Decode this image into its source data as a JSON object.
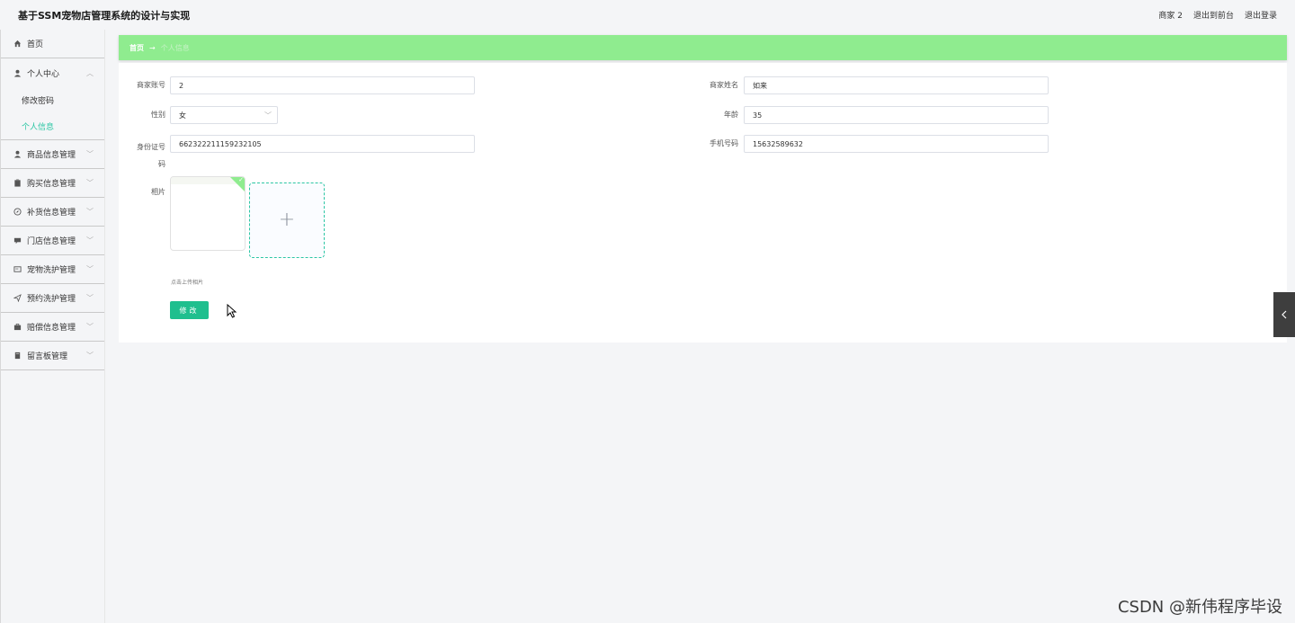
{
  "header": {
    "title": "基于SSM宠物店管理系统的设计与实现",
    "user": "商家 2",
    "front_link": "退出到前台",
    "logout": "退出登录"
  },
  "sidebar": {
    "items": [
      {
        "label": "首页",
        "icon": "home-icon"
      },
      {
        "label": "个人中心",
        "icon": "user-icon"
      },
      {
        "label": "修改密码"
      },
      {
        "label": "个人信息"
      },
      {
        "label": "商品信息管理",
        "icon": "user-icon"
      },
      {
        "label": "购买信息管理",
        "icon": "clipboard-icon"
      },
      {
        "label": "补货信息管理",
        "icon": "compass-icon"
      },
      {
        "label": "门店信息管理",
        "icon": "chat-icon"
      },
      {
        "label": "宠物洗护管理",
        "icon": "card-icon"
      },
      {
        "label": "预约洗护管理",
        "icon": "send-icon"
      },
      {
        "label": "赔偿信息管理",
        "icon": "briefcase-icon"
      },
      {
        "label": "留言板管理",
        "icon": "notebook-icon"
      }
    ]
  },
  "breadcrumb": {
    "home": "首页",
    "current": "个人信息"
  },
  "form": {
    "account_label": "商家账号",
    "account_value": "2",
    "name_label": "商家姓名",
    "name_value": "如来",
    "gender_label": "性别",
    "gender_value": "女",
    "age_label": "年龄",
    "age_value": "35",
    "idcard_label": "身份证号码",
    "idcard_value": "662322211159232105",
    "phone_label": "手机号码",
    "phone_value": "15632589632",
    "photo_label": "相片",
    "upload_hint": "点击上传相片",
    "submit_label": "修改"
  },
  "watermark": "CSDN @新伟程序毕设",
  "colors": {
    "accent": "#2cc6a4",
    "breadcrumb_bg": "#8fec8f",
    "button": "#1fbf8e"
  }
}
